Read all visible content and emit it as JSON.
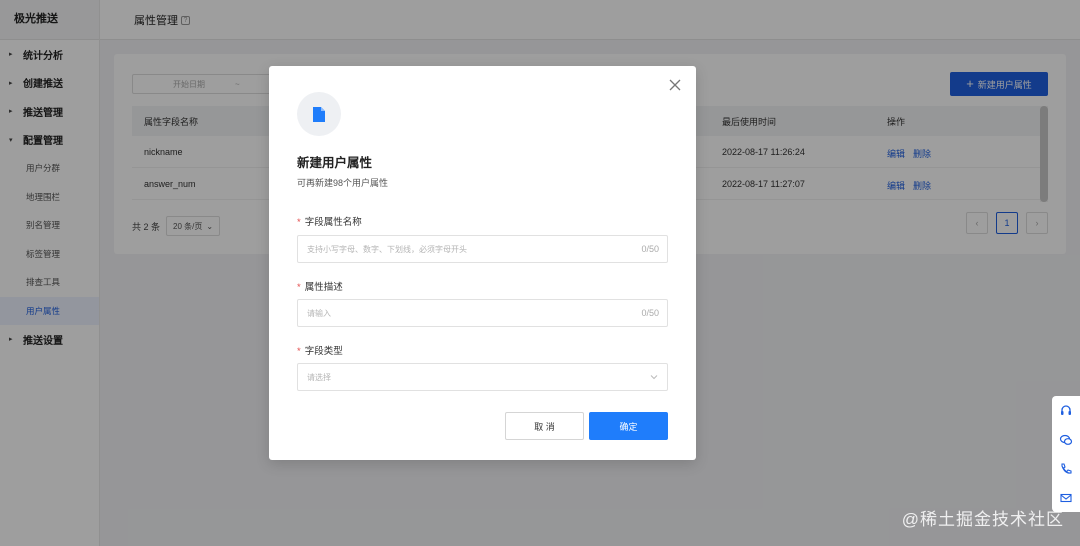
{
  "sidebar": {
    "brand": "极光推送",
    "groups": [
      {
        "label": "统计分析"
      },
      {
        "label": "创建推送"
      },
      {
        "label": "推送管理"
      },
      {
        "label": "配置管理"
      }
    ],
    "sub_items": [
      {
        "label": "用户分群"
      },
      {
        "label": "地理围栏"
      },
      {
        "label": "别名管理"
      },
      {
        "label": "标签管理"
      },
      {
        "label": "排查工具"
      },
      {
        "label": "用户属性"
      }
    ],
    "last_group": {
      "label": "推送设置"
    }
  },
  "header": {
    "title": "属性管理"
  },
  "main": {
    "date_placeholder": "开始日期",
    "date_separator": "~",
    "new_button": "新建用户属性",
    "columns": [
      "属性字段名称",
      "最后使用时间",
      "操作"
    ],
    "rows": [
      {
        "name": "nickname",
        "last_used": "2022-08-17 11:26:24",
        "edit": "编辑",
        "delete": "删除"
      },
      {
        "name": "answer_num",
        "last_used": "2022-08-17 11:27:07",
        "edit": "编辑",
        "delete": "删除"
      }
    ],
    "total": "共 2 条",
    "page_size": "20 条/页",
    "current_page": "1"
  },
  "modal": {
    "title": "新建用户属性",
    "subtitle": "可再新建98个用户属性",
    "fields": [
      {
        "label": "字段属性名称",
        "placeholder": "支持小写字母、数字、下划线，必须字母开头",
        "counter": "0/50"
      },
      {
        "label": "属性描述",
        "placeholder": "请输入",
        "counter": "0/50"
      },
      {
        "label": "字段类型",
        "placeholder": "请选择"
      }
    ],
    "cancel": "取 消",
    "confirm": "确定"
  },
  "watermark": "@稀土掘金技术社区",
  "colors": {
    "accent": "#1f5fe0",
    "primary_button": "#1f7dfb",
    "required": "#e34d4d"
  }
}
